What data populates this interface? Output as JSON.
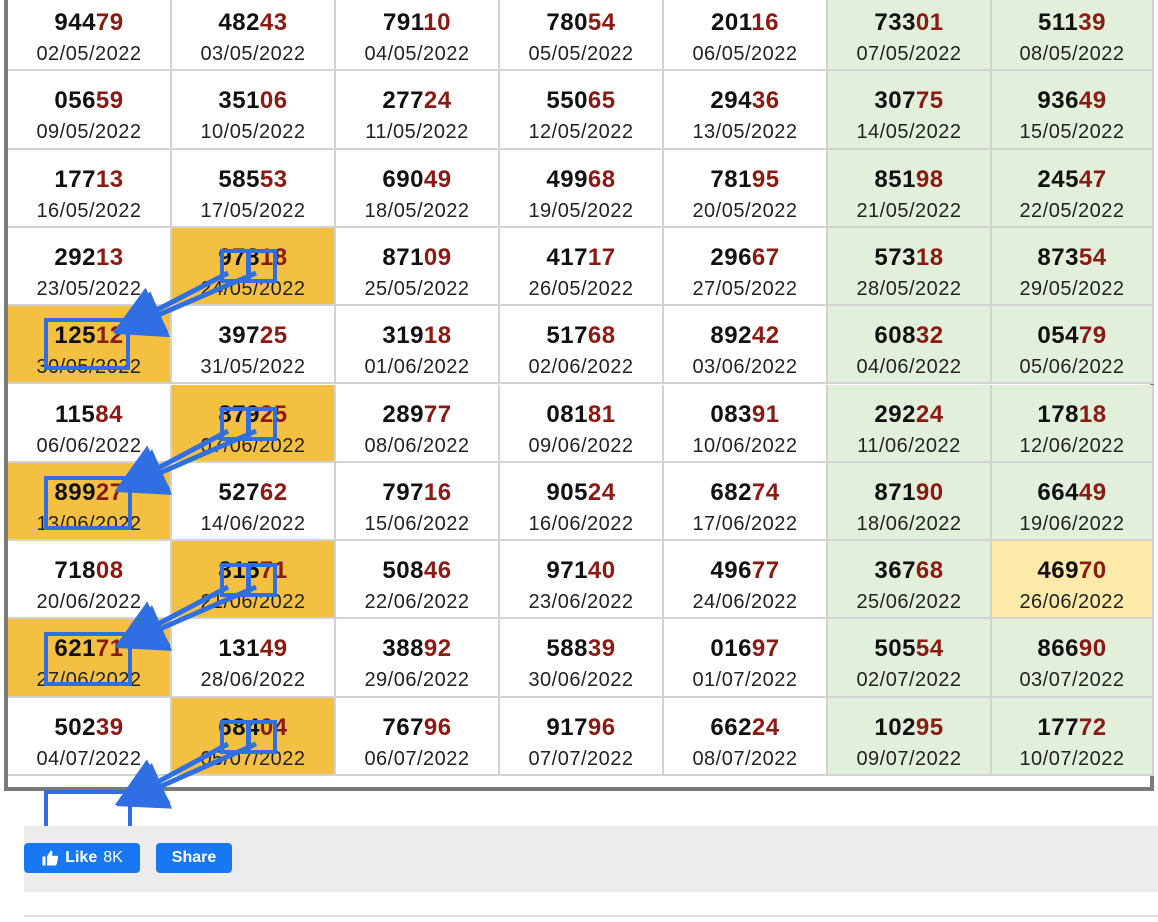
{
  "colors": {
    "weekend_bg": "#e2efda",
    "highlight_bg": "#f4c042",
    "soft_highlight_bg": "#fde9a8",
    "tail_digits": "#8b1a12",
    "annotation": "#2f6ee3",
    "facebook_blue": "#1877f2"
  },
  "rows": [
    [
      {
        "head": "944",
        "tail": "79",
        "date": "02/05/2022"
      },
      {
        "head": "482",
        "tail": "43",
        "date": "03/05/2022"
      },
      {
        "head": "791",
        "tail": "10",
        "date": "04/05/2022"
      },
      {
        "head": "780",
        "tail": "54",
        "date": "05/05/2022"
      },
      {
        "head": "201",
        "tail": "16",
        "date": "06/05/2022"
      },
      {
        "head": "733",
        "tail": "01",
        "date": "07/05/2022",
        "style": "weekend"
      },
      {
        "head": "511",
        "tail": "39",
        "date": "08/05/2022",
        "style": "weekend"
      }
    ],
    [
      {
        "head": "056",
        "tail": "59",
        "date": "09/05/2022"
      },
      {
        "head": "351",
        "tail": "06",
        "date": "10/05/2022"
      },
      {
        "head": "277",
        "tail": "24",
        "date": "11/05/2022"
      },
      {
        "head": "550",
        "tail": "65",
        "date": "12/05/2022"
      },
      {
        "head": "294",
        "tail": "36",
        "date": "13/05/2022"
      },
      {
        "head": "307",
        "tail": "75",
        "date": "14/05/2022",
        "style": "weekend"
      },
      {
        "head": "936",
        "tail": "49",
        "date": "15/05/2022",
        "style": "weekend"
      }
    ],
    [
      {
        "head": "177",
        "tail": "13",
        "date": "16/05/2022"
      },
      {
        "head": "585",
        "tail": "53",
        "date": "17/05/2022"
      },
      {
        "head": "690",
        "tail": "49",
        "date": "18/05/2022"
      },
      {
        "head": "499",
        "tail": "68",
        "date": "19/05/2022"
      },
      {
        "head": "781",
        "tail": "95",
        "date": "20/05/2022"
      },
      {
        "head": "851",
        "tail": "98",
        "date": "21/05/2022",
        "style": "weekend"
      },
      {
        "head": "245",
        "tail": "47",
        "date": "22/05/2022",
        "style": "weekend"
      }
    ],
    [
      {
        "head": "292",
        "tail": "13",
        "date": "23/05/2022"
      },
      {
        "head": "978",
        "tail": "18",
        "date": "24/05/2022",
        "style": "hl"
      },
      {
        "head": "871",
        "tail": "09",
        "date": "25/05/2022"
      },
      {
        "head": "417",
        "tail": "17",
        "date": "26/05/2022"
      },
      {
        "head": "296",
        "tail": "67",
        "date": "27/05/2022"
      },
      {
        "head": "573",
        "tail": "18",
        "date": "28/05/2022",
        "style": "weekend"
      },
      {
        "head": "873",
        "tail": "54",
        "date": "29/05/2022",
        "style": "weekend"
      }
    ],
    [
      {
        "head": "125",
        "tail": "12",
        "date": "30/05/2022",
        "style": "hl"
      },
      {
        "head": "397",
        "tail": "25",
        "date": "31/05/2022"
      },
      {
        "head": "319",
        "tail": "18",
        "date": "01/06/2022"
      },
      {
        "head": "517",
        "tail": "68",
        "date": "02/06/2022"
      },
      {
        "head": "892",
        "tail": "42",
        "date": "03/06/2022"
      },
      {
        "head": "608",
        "tail": "32",
        "date": "04/06/2022",
        "style": "weekend"
      },
      {
        "head": "054",
        "tail": "79",
        "date": "05/06/2022",
        "style": "weekend"
      }
    ],
    [
      {
        "head": "115",
        "tail": "84",
        "date": "06/06/2022"
      },
      {
        "head": "879",
        "tail": "25",
        "date": "07/06/2022",
        "style": "hl"
      },
      {
        "head": "289",
        "tail": "77",
        "date": "08/06/2022"
      },
      {
        "head": "081",
        "tail": "81",
        "date": "09/06/2022"
      },
      {
        "head": "083",
        "tail": "91",
        "date": "10/06/2022"
      },
      {
        "head": "292",
        "tail": "24",
        "date": "11/06/2022",
        "style": "weekend"
      },
      {
        "head": "178",
        "tail": "18",
        "date": "12/06/2022",
        "style": "weekend"
      }
    ],
    [
      {
        "head": "899",
        "tail": "27",
        "date": "13/06/2022",
        "style": "hl"
      },
      {
        "head": "527",
        "tail": "62",
        "date": "14/06/2022"
      },
      {
        "head": "797",
        "tail": "16",
        "date": "15/06/2022"
      },
      {
        "head": "905",
        "tail": "24",
        "date": "16/06/2022"
      },
      {
        "head": "682",
        "tail": "74",
        "date": "17/06/2022"
      },
      {
        "head": "871",
        "tail": "90",
        "date": "18/06/2022",
        "style": "weekend"
      },
      {
        "head": "664",
        "tail": "49",
        "date": "19/06/2022",
        "style": "weekend"
      }
    ],
    [
      {
        "head": "718",
        "tail": "08",
        "date": "20/06/2022"
      },
      {
        "head": "815",
        "tail": "71",
        "date": "21/06/2022",
        "style": "hl"
      },
      {
        "head": "508",
        "tail": "46",
        "date": "22/06/2022"
      },
      {
        "head": "971",
        "tail": "40",
        "date": "23/06/2022"
      },
      {
        "head": "496",
        "tail": "77",
        "date": "24/06/2022"
      },
      {
        "head": "367",
        "tail": "68",
        "date": "25/06/2022",
        "style": "weekend"
      },
      {
        "head": "469",
        "tail": "70",
        "date": "26/06/2022",
        "style": "soft"
      }
    ],
    [
      {
        "head": "621",
        "tail": "71",
        "date": "27/06/2022",
        "style": "hl"
      },
      {
        "head": "131",
        "tail": "49",
        "date": "28/06/2022"
      },
      {
        "head": "388",
        "tail": "92",
        "date": "29/06/2022"
      },
      {
        "head": "588",
        "tail": "39",
        "date": "30/06/2022"
      },
      {
        "head": "016",
        "tail": "97",
        "date": "01/07/2022"
      },
      {
        "head": "505",
        "tail": "54",
        "date": "02/07/2022",
        "style": "weekend"
      },
      {
        "head": "866",
        "tail": "90",
        "date": "03/07/2022",
        "style": "weekend"
      }
    ],
    [
      {
        "head": "502",
        "tail": "39",
        "date": "04/07/2022"
      },
      {
        "head": "684",
        "tail": "04",
        "date": "05/07/2022",
        "style": "hl"
      },
      {
        "head": "767",
        "tail": "96",
        "date": "06/07/2022"
      },
      {
        "head": "917",
        "tail": "96",
        "date": "07/07/2022"
      },
      {
        "head": "662",
        "tail": "24",
        "date": "08/07/2022"
      },
      {
        "head": "102",
        "tail": "95",
        "date": "09/07/2022",
        "style": "weekend"
      },
      {
        "head": "177",
        "tail": "72",
        "date": "10/07/2022",
        "style": "weekend"
      }
    ]
  ],
  "social": {
    "like_label": "Like",
    "like_count": "8K",
    "share_label": "Share",
    "like_icon": "thumbs-up-icon"
  }
}
